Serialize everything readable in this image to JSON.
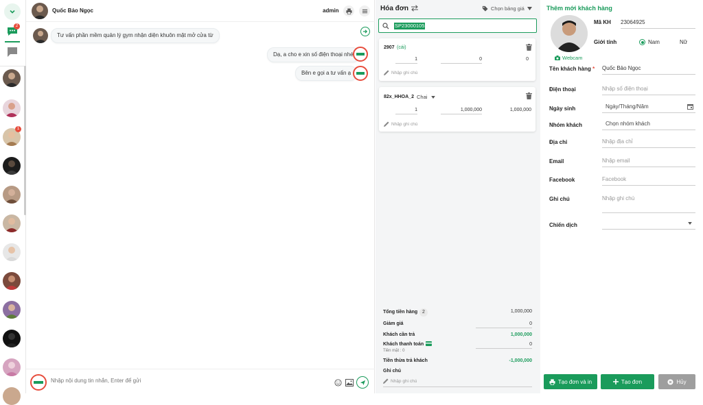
{
  "rail": {
    "badge_count": "2",
    "contact_badge": "1"
  },
  "chat": {
    "contact_name": "Quốc Bảo Ngọc",
    "agent": "admin",
    "messages": [
      {
        "side": "left",
        "text": "Tư vấn phần mềm quản lý gym nhận diện khuôn mặt mở cửa từ"
      },
      {
        "side": "right",
        "text": "Dạ, a cho e xin số điện thoại nhé"
      },
      {
        "side": "right",
        "text": "Bên e gọi a tư vấn ạ"
      }
    ],
    "composer_placeholder": "Nhập nội dung tin nhắn, Enter để gửi"
  },
  "invoice": {
    "title": "Hóa đơn",
    "price_list": "Chọn bảng giá",
    "search_value": "SP23000105",
    "items": [
      {
        "code": "2907",
        "unit": "(cái)",
        "qty": "1",
        "price": "0",
        "total": "0",
        "note_placeholder": "Nhập ghi chú"
      },
      {
        "code": "82x_HHOA_2",
        "unit": "Chai",
        "qty": "1",
        "price": "1,000,000",
        "total": "1,000,000",
        "note_placeholder": "Nhập ghi chú"
      }
    ],
    "summary": {
      "total_label": "Tổng tiền hàng",
      "total_count": "2",
      "total_value": "1,000,000",
      "discount_label": "Giảm giá",
      "discount_value": "0",
      "need_pay_label": "Khách cần trả",
      "need_pay_value": "1,000,000",
      "paid_label": "Khách thanh toán",
      "paid_value": "0",
      "cash_label": "Tiền mặt : 0",
      "change_label": "Tiền thừa trả khách",
      "change_value": "-1,000,000",
      "note_label": "Ghi chú",
      "note_placeholder": "Nhập ghi chú"
    }
  },
  "customer": {
    "title": "Thêm mới khách hàng",
    "code_label": "Mã KH",
    "code_value": "23064925",
    "gender_label": "Giới tính",
    "gender_male": "Nam",
    "gender_female": "Nữ",
    "webcam": "Webcam",
    "name_label": "Tên khách hàng",
    "required_mark": "*",
    "name_value": "Quốc Bảo Ngọc",
    "phone_label": "Điện thoại",
    "phone_placeholder": "Nhập số điện thoại",
    "dob_label": "Ngày sinh",
    "dob_placeholder": "Ngày/Tháng/Năm",
    "group_label": "Nhóm khách",
    "group_placeholder": "Chọn nhóm khách",
    "address_label": "Địa chỉ",
    "address_placeholder": "Nhập địa chỉ",
    "email_label": "Email",
    "email_placeholder": "Nhập email",
    "facebook_label": "Facebook",
    "facebook_placeholder": "Facebook",
    "note_label": "Ghi chú",
    "note_placeholder": "Nhập ghi chú",
    "campaign_label": "Chiến dịch"
  },
  "actions": {
    "create_print": "Tạo đơn và in",
    "create": "Tạo đơn",
    "cancel": "Hủy"
  },
  "colors": {
    "accent": "#1a9b5b",
    "badge": "#e74c3c",
    "cancel": "#9e9e9e"
  }
}
